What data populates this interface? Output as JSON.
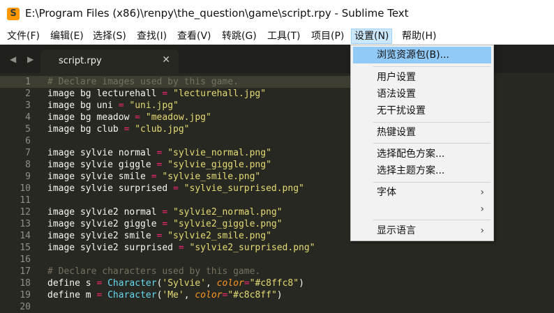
{
  "window": {
    "title": "E:\\Program Files (x86)\\renpy\\the_question\\game\\script.rpy - Sublime Text"
  },
  "menubar": {
    "items": [
      {
        "label": "文件(F)"
      },
      {
        "label": "编辑(E)"
      },
      {
        "label": "选择(S)"
      },
      {
        "label": "查找(I)"
      },
      {
        "label": "查看(V)"
      },
      {
        "label": "转跳(G)"
      },
      {
        "label": "工具(T)"
      },
      {
        "label": "项目(P)"
      },
      {
        "label": "设置(N)",
        "active": true
      },
      {
        "label": "帮助(H)"
      }
    ]
  },
  "tabs": {
    "nav_arrows": "◀ ▶",
    "active_tab": {
      "label": "script.rpy",
      "close": "✕"
    }
  },
  "settings_menu": {
    "items": [
      {
        "label": "浏览资源包(B)...",
        "highlighted": true
      },
      {
        "label": "用户设置"
      },
      {
        "label": "语法设置"
      },
      {
        "label": "无干扰设置"
      },
      {
        "label": "热键设置"
      },
      {
        "label": "选择配色方案..."
      },
      {
        "label": "选择主题方案..."
      },
      {
        "label": "字体",
        "submenu": true
      },
      {
        "label": "",
        "submenu": true
      },
      {
        "label": "显示语言",
        "submenu": true
      }
    ],
    "submenu_arrow": "›"
  },
  "editor": {
    "lines": [
      {
        "n": "1",
        "tokens": [
          {
            "t": "# Declare images used by this game.",
            "c": "comment"
          }
        ]
      },
      {
        "n": "2",
        "tokens": [
          {
            "t": "image bg lecturehall "
          },
          {
            "t": "=",
            "c": "op"
          },
          {
            "t": " "
          },
          {
            "t": "\"lecturehall.jpg\"",
            "c": "string"
          }
        ]
      },
      {
        "n": "3",
        "tokens": [
          {
            "t": "image bg uni "
          },
          {
            "t": "=",
            "c": "op"
          },
          {
            "t": " "
          },
          {
            "t": "\"uni.jpg\"",
            "c": "string"
          }
        ]
      },
      {
        "n": "4",
        "tokens": [
          {
            "t": "image bg meadow "
          },
          {
            "t": "=",
            "c": "op"
          },
          {
            "t": " "
          },
          {
            "t": "\"meadow.jpg\"",
            "c": "string"
          }
        ]
      },
      {
        "n": "5",
        "tokens": [
          {
            "t": "image bg club "
          },
          {
            "t": "=",
            "c": "op"
          },
          {
            "t": " "
          },
          {
            "t": "\"club.jpg\"",
            "c": "string"
          }
        ]
      },
      {
        "n": "6",
        "tokens": []
      },
      {
        "n": "7",
        "tokens": [
          {
            "t": "image sylvie normal "
          },
          {
            "t": "=",
            "c": "op"
          },
          {
            "t": " "
          },
          {
            "t": "\"sylvie_normal.png\"",
            "c": "string"
          }
        ]
      },
      {
        "n": "8",
        "tokens": [
          {
            "t": "image sylvie giggle "
          },
          {
            "t": "=",
            "c": "op"
          },
          {
            "t": " "
          },
          {
            "t": "\"sylvie_giggle.png\"",
            "c": "string"
          }
        ]
      },
      {
        "n": "9",
        "tokens": [
          {
            "t": "image sylvie smile "
          },
          {
            "t": "=",
            "c": "op"
          },
          {
            "t": " "
          },
          {
            "t": "\"sylvie_smile.png\"",
            "c": "string"
          }
        ]
      },
      {
        "n": "10",
        "tokens": [
          {
            "t": "image sylvie surprised "
          },
          {
            "t": "=",
            "c": "op"
          },
          {
            "t": " "
          },
          {
            "t": "\"sylvie_surprised.png\"",
            "c": "string"
          }
        ]
      },
      {
        "n": "11",
        "tokens": []
      },
      {
        "n": "12",
        "tokens": [
          {
            "t": "image sylvie2 normal "
          },
          {
            "t": "=",
            "c": "op"
          },
          {
            "t": " "
          },
          {
            "t": "\"sylvie2_normal.png\"",
            "c": "string"
          }
        ]
      },
      {
        "n": "13",
        "tokens": [
          {
            "t": "image sylvie2 giggle "
          },
          {
            "t": "=",
            "c": "op"
          },
          {
            "t": " "
          },
          {
            "t": "\"sylvie2_giggle.png\"",
            "c": "string"
          }
        ]
      },
      {
        "n": "14",
        "tokens": [
          {
            "t": "image sylvie2 smile "
          },
          {
            "t": "=",
            "c": "op"
          },
          {
            "t": " "
          },
          {
            "t": "\"sylvie2_smile.png\"",
            "c": "string"
          }
        ]
      },
      {
        "n": "15",
        "tokens": [
          {
            "t": "image sylvie2 surprised "
          },
          {
            "t": "=",
            "c": "op"
          },
          {
            "t": " "
          },
          {
            "t": "\"sylvie2_surprised.png\"",
            "c": "string"
          }
        ]
      },
      {
        "n": "16",
        "tokens": []
      },
      {
        "n": "17",
        "tokens": [
          {
            "t": "# Declare characters used by this game.",
            "c": "comment"
          }
        ]
      },
      {
        "n": "18",
        "tokens": [
          {
            "t": "define s "
          },
          {
            "t": "=",
            "c": "op"
          },
          {
            "t": " "
          },
          {
            "t": "Character",
            "c": "func"
          },
          {
            "t": "("
          },
          {
            "t": "'Sylvie'",
            "c": "string"
          },
          {
            "t": ", "
          },
          {
            "t": "color",
            "c": "param"
          },
          {
            "t": "=",
            "c": "op"
          },
          {
            "t": "\"#c8ffc8\"",
            "c": "string"
          },
          {
            "t": ")"
          }
        ]
      },
      {
        "n": "19",
        "tokens": [
          {
            "t": "define m "
          },
          {
            "t": "=",
            "c": "op"
          },
          {
            "t": " "
          },
          {
            "t": "Character",
            "c": "func"
          },
          {
            "t": "("
          },
          {
            "t": "'Me'",
            "c": "string"
          },
          {
            "t": ", "
          },
          {
            "t": "color",
            "c": "param"
          },
          {
            "t": "=",
            "c": "op"
          },
          {
            "t": "\"#c8c8ff\"",
            "c": "string"
          },
          {
            "t": ")"
          }
        ]
      },
      {
        "n": "20",
        "tokens": []
      }
    ]
  },
  "colors": {
    "editor_bg": "#272822",
    "comment": "#75715e",
    "string": "#e6db74",
    "operator": "#f92672",
    "function": "#66d9ef",
    "parameter": "#fd971f",
    "menu_highlight": "#91c9f7"
  }
}
